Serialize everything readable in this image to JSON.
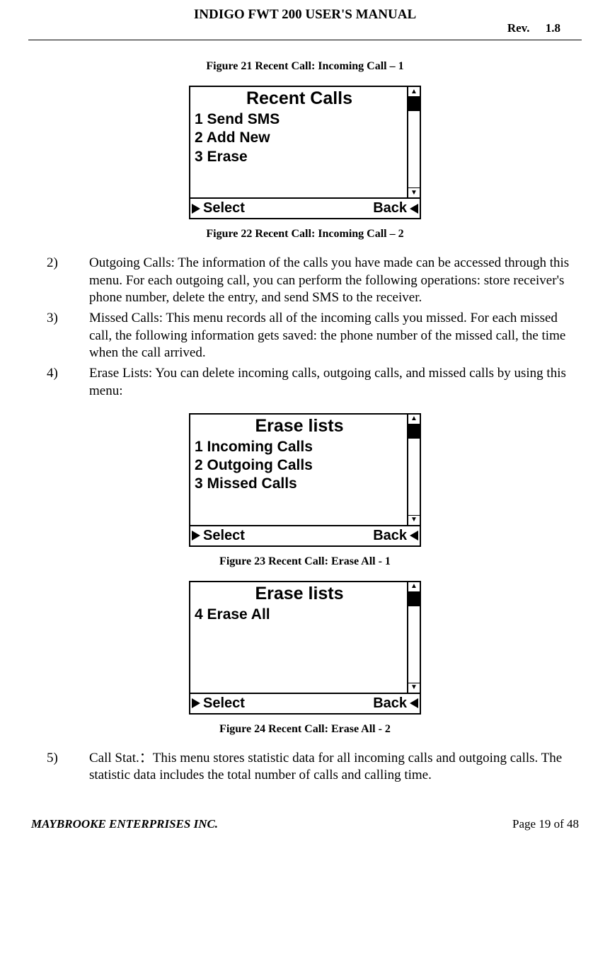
{
  "header": {
    "title": "INDIGO FWT 200 USER'S MANUAL",
    "rev_label": "Rev.",
    "rev_value": "1.8"
  },
  "fig21_caption": "Figure 21  Recent Call: Incoming Call – 1",
  "screen22": {
    "title": "Recent Calls",
    "items": [
      "1 Send SMS",
      "2 Add New",
      "3 Erase"
    ],
    "sk_left": "Select",
    "sk_right": "Back"
  },
  "fig22_caption": "Figure 22  Recent Call: Incoming Call – 2",
  "list_a": {
    "item2": {
      "num": "2)",
      "text": "Outgoing Calls: The information of the calls you have made can be accessed through this menu. For each outgoing call, you can perform the following operations: store receiver's phone number, delete the entry, and send SMS to the receiver."
    },
    "item3": {
      "num": "3)",
      "text": "Missed Calls: This menu records all of the incoming calls you missed.  For each missed call, the following information gets saved: the phone number of the missed call, the time when the call arrived."
    },
    "item4": {
      "num": "4)",
      "text": "Erase Lists:  You can delete incoming calls, outgoing calls, and missed calls by using this menu:"
    }
  },
  "screen23": {
    "title": "Erase lists",
    "items": [
      "1 Incoming Calls",
      "2 Outgoing Calls",
      "3 Missed Calls"
    ],
    "sk_left": "Select",
    "sk_right": "Back"
  },
  "fig23_caption": "Figure 23  Recent Call: Erase All  - 1",
  "screen24": {
    "title": "Erase lists",
    "items": [
      "4 Erase All"
    ],
    "sk_left": "Select",
    "sk_right": "Back"
  },
  "fig24_caption": "Figure 24  Recent Call: Erase All - 2",
  "list_b": {
    "item5": {
      "num": "5)",
      "text": "Call Stat.：This menu stores statistic data for all incoming calls and outgoing calls. The statistic data includes the total number of calls and calling time."
    }
  },
  "footer": {
    "left": "MAYBROOKE ENTERPRISES INC.",
    "right": "Page 19 of 48"
  }
}
